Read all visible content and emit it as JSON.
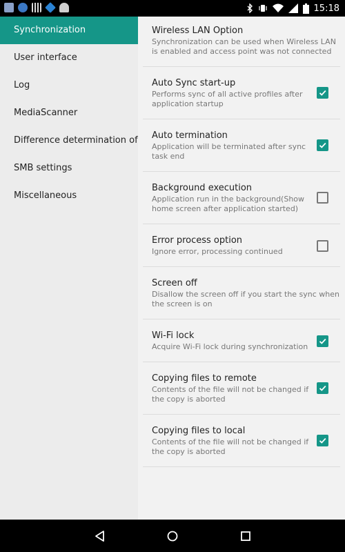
{
  "status_bar": {
    "time": "15:18",
    "icons": [
      "app-icon-1",
      "globe-icon",
      "grid-icon",
      "dropbox-icon",
      "android-icon",
      "bluetooth-icon",
      "vibrate-icon",
      "wifi-icon",
      "cell-signal-icon",
      "battery-icon"
    ]
  },
  "sidebar": {
    "items": [
      {
        "label": "Synchronization",
        "active": true
      },
      {
        "label": "User interface"
      },
      {
        "label": "Log"
      },
      {
        "label": "MediaScanner"
      },
      {
        "label": "Difference determination of f"
      },
      {
        "label": "SMB settings"
      },
      {
        "label": "Miscellaneous"
      }
    ]
  },
  "detail": {
    "prefs": [
      {
        "title": "Wireless LAN Option",
        "summary": "Synchronization can be used when Wireless LAN\nis enabled and access point was not connected"
      },
      {
        "title": "Auto Sync start-up",
        "summary": "Performs sync of all active profiles after\napplication startup",
        "checked": true
      },
      {
        "title": "Auto termination",
        "summary": "Application will be terminated after sync\ntask end",
        "checked": true
      },
      {
        "title": "Background execution",
        "summary": "Application run in the background(Show\nhome screen after application started)",
        "checked": false
      },
      {
        "title": "Error process option",
        "summary": "Ignore error, processing continued",
        "checked": false
      },
      {
        "title": "Screen off",
        "summary": "Disallow the screen off if you start the sync when\nthe screen is on"
      },
      {
        "title": "Wi-Fi lock",
        "summary": "Acquire Wi-Fi lock during synchronization",
        "checked": true
      },
      {
        "title": "Copying files to remote",
        "summary": "Contents of the file will not be changed if\nthe copy is aborted",
        "checked": true
      },
      {
        "title": "Copying files to local",
        "summary": "Contents of the file will not be changed if\nthe copy is aborted",
        "checked": true
      }
    ]
  },
  "nav_bar": {
    "buttons": [
      "back-icon",
      "home-icon",
      "recents-icon"
    ]
  },
  "colors": {
    "accent": "#159688",
    "status_bar": "#000000",
    "sidebar_bg": "#ececec"
  }
}
